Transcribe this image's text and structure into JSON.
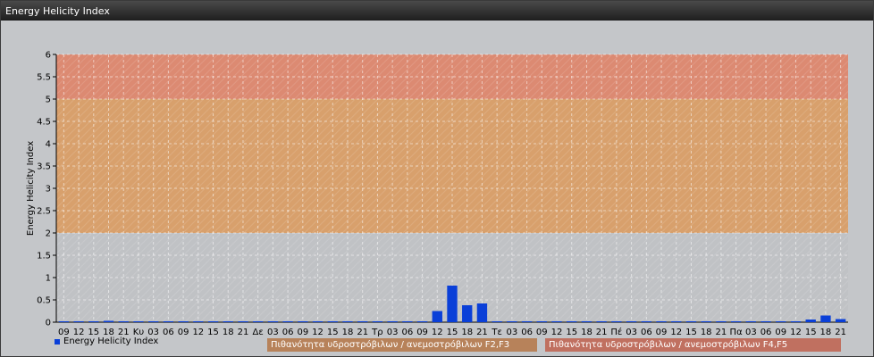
{
  "window": {
    "title": "Energy Helicity Index"
  },
  "colors": {
    "bar": "#0a3fd8",
    "band_low": "#c0c2c5",
    "band_mid": "#d8a06c",
    "band_high": "#dc8a72",
    "legend_mid": "#b7825a",
    "legend_high": "#c07060"
  },
  "chart_data": {
    "type": "bar",
    "ylabel": "Energy Helicity Index",
    "ylim": [
      0,
      6
    ],
    "yticks": [
      "0",
      "0.5",
      "1",
      "1.5",
      "2",
      "2.5",
      "3",
      "3.5",
      "4",
      "4.5",
      "5",
      "5.5",
      "6"
    ],
    "categories": [
      "09",
      "12",
      "15",
      "18",
      "21",
      "Κυ",
      "03",
      "06",
      "09",
      "12",
      "15",
      "18",
      "21",
      "Δε",
      "03",
      "06",
      "09",
      "12",
      "15",
      "18",
      "21",
      "Τρ",
      "03",
      "06",
      "09",
      "12",
      "15",
      "18",
      "21",
      "Τε",
      "03",
      "06",
      "09",
      "12",
      "15",
      "18",
      "21",
      "Πέ",
      "03",
      "06",
      "09",
      "12",
      "15",
      "18",
      "21",
      "Πα",
      "03",
      "06",
      "09",
      "12",
      "15",
      "18",
      "21"
    ],
    "values": [
      0.02,
      0.02,
      0.02,
      0.03,
      0.02,
      0.02,
      0.02,
      0.02,
      0.02,
      0.02,
      0.02,
      0.02,
      0.02,
      0.02,
      0.02,
      0.02,
      0.02,
      0.02,
      0.02,
      0.02,
      0.02,
      0.02,
      0.02,
      0.02,
      0.02,
      0.25,
      0.82,
      0.38,
      0.42,
      0.02,
      0.02,
      0.02,
      0.02,
      0.02,
      0.02,
      0.02,
      0.02,
      0.02,
      0.02,
      0.02,
      0.02,
      0.02,
      0.02,
      0.02,
      0.02,
      0.02,
      0.02,
      0.02,
      0.02,
      0.02,
      0.06,
      0.15,
      0.07
    ],
    "bands": [
      {
        "from": 0,
        "to": 2
      },
      {
        "from": 2,
        "to": 5
      },
      {
        "from": 5,
        "to": 6
      }
    ],
    "grid": true,
    "legend": {
      "series_name": "Energy Helicity Index",
      "band_mid": "Πιθανότητα υδροστρόβιλων / ανεμοστρόβιλων F2,F3",
      "band_high": "Πιθανότητα υδροστρόβιλων / ανεμοστρόβιλων F4,F5"
    }
  }
}
